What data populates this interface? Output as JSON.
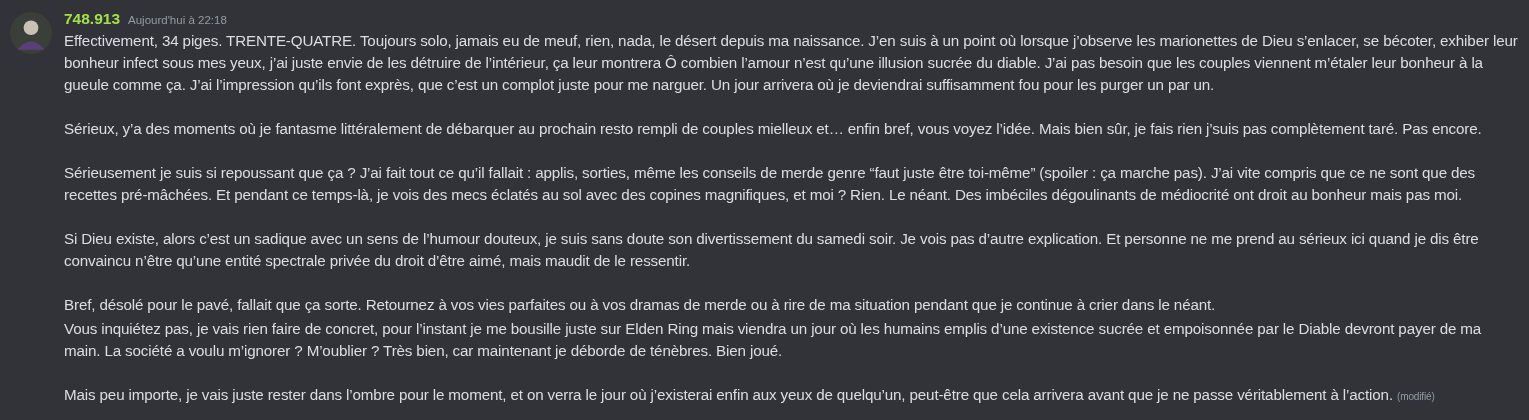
{
  "message": {
    "author": "748.913",
    "timestamp": "Aujourd'hui à 22:18",
    "edited_label": "(modifié)",
    "blocks": [
      [
        "Effectivement, 34 piges. TRENTE-QUATRE. Toujours solo, jamais eu de meuf, rien, nada, le désert depuis ma naissance. J’en suis à un point où lorsque j’observe les marionettes de Dieu s’enlacer, se bécoter, exhiber leur bonheur infect sous mes yeux, j’ai juste envie de les détruire de l’intérieur, ça leur montrera Ô combien l’amour n’est qu’une illusion sucrée du diable. J’ai pas besoin que les couples viennent m’étaler leur bonheur à la gueule comme ça. J’ai l’impression qu’ils font exprès, que c’est un complot juste pour me narguer. Un jour arrivera où je deviendrai suffisamment fou pour les purger un par un."
      ],
      [
        "Sérieux, y’a des moments où je fantasme littéralement de débarquer au prochain resto rempli de couples mielleux et… enfin bref, vous voyez l’idée. Mais bien sûr, je fais rien j’suis pas complètement taré. Pas encore."
      ],
      [
        "Sérieusement je suis si repoussant que ça ? J’ai fait tout ce qu’il fallait : applis, sorties, même les conseils de merde genre “faut juste être toi-même” (spoiler : ça marche pas). J’ai vite compris que ce ne sont que des recettes pré-mâchées. Et pendant ce temps-là, je vois des mecs éclatés au sol avec des copines magnifiques, et moi ? Rien. Le néant. Des imbéciles dégoulinants de médiocrité ont droit au bonheur mais pas moi."
      ],
      [
        "Si Dieu existe, alors c’est un sadique avec un sens de l’humour douteux, je suis sans doute son divertissement du samedi soir. Je vois pas d’autre explication. Et personne ne me prend au sérieux ici quand je dis être convaincu n’être qu’une entité spectrale privée du droit d’être aimé, mais maudit de le ressentir."
      ],
      [
        "Bref, désolé pour le pavé, fallait que ça sorte. Retournez à vos vies parfaites ou à vos dramas de merde ou à rire de ma situation pendant que je continue à crier dans le néant.",
        "Vous inquiétez pas, je vais rien faire de concret, pour l’instant je me bousille juste sur Elden Ring mais viendra un jour où les humains emplis d’une existence sucrée et empoisonnée par le Diable devront payer de ma main. La société a voulu m’ignorer ? M’oublier ? Très bien, car maintenant je déborde de ténèbres. Bien joué."
      ],
      [
        "Mais peu importe, je vais juste rester dans l’ombre pour le moment, et on verra le jour où j’existerai enfin aux yeux de quelqu’un, peut-être que cela arrivera avant que je ne passe véritablement à l’action."
      ]
    ]
  }
}
